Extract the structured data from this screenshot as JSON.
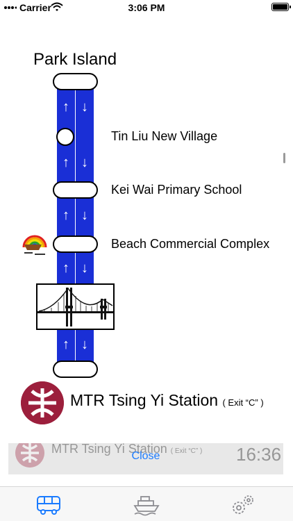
{
  "status_bar": {
    "carrier": "Carrier",
    "time": "3:06 PM"
  },
  "route": {
    "title": "Park Island",
    "stops": [
      {
        "name": "Tin Liu New Village"
      },
      {
        "name": "Kei Wai Primary School"
      },
      {
        "name": "Beach Commercial Complex"
      }
    ],
    "destination": {
      "name": "MTR Tsing Yi Station",
      "exit": "( Exit “C” )"
    },
    "line_color": "#1a2fd6"
  },
  "info_card": {
    "station": "MTR Tsing Yi Station",
    "exit": "( Exit “C” )",
    "countdown": "16:36",
    "close_label": "Close"
  },
  "tab_bar": {
    "tabs": [
      {
        "icon": "bus-icon",
        "selected": true
      },
      {
        "icon": "ferry-icon",
        "selected": false
      },
      {
        "icon": "settings-gear-icon",
        "selected": false
      }
    ],
    "accent": "#1a7bff"
  },
  "colors": {
    "mtr_brand": "#9c1f3c"
  }
}
